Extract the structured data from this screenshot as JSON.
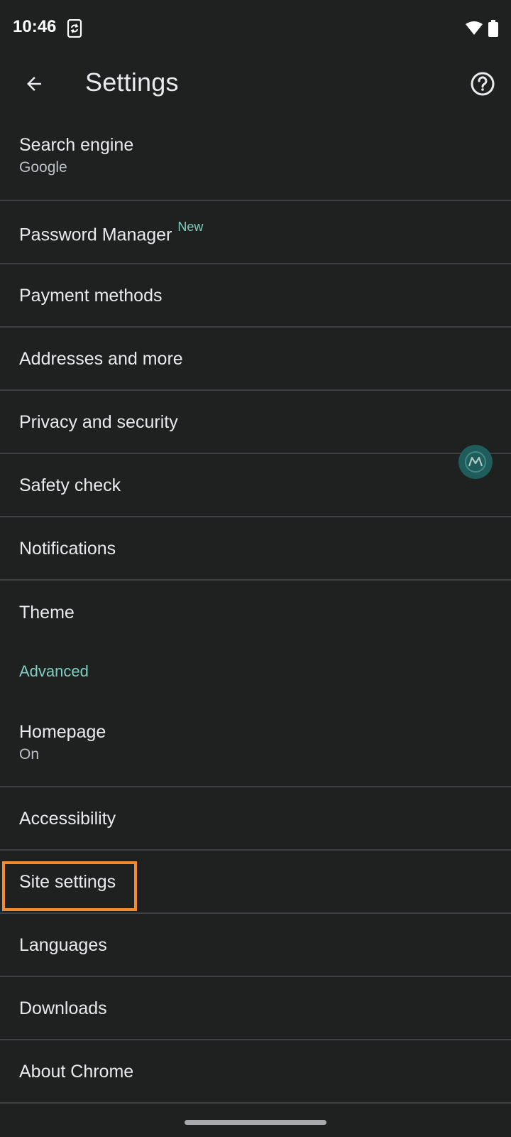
{
  "status_bar": {
    "time": "10:46",
    "icons": [
      "sync-icon",
      "wifi-icon",
      "battery-icon"
    ]
  },
  "app_bar": {
    "title": "Settings",
    "back_icon": "arrow-back-icon",
    "help_icon": "help-circle-icon"
  },
  "settings": {
    "search_engine": {
      "title": "Search engine",
      "subtitle": "Google"
    },
    "password_manager": {
      "title": "Password Manager",
      "badge": "New"
    },
    "payment_methods": {
      "title": "Payment methods"
    },
    "addresses": {
      "title": "Addresses and more"
    },
    "privacy": {
      "title": "Privacy and security"
    },
    "safety_check": {
      "title": "Safety check"
    },
    "notifications": {
      "title": "Notifications"
    },
    "theme": {
      "title": "Theme"
    },
    "advanced_header": "Advanced",
    "homepage": {
      "title": "Homepage",
      "subtitle": "On"
    },
    "accessibility": {
      "title": "Accessibility"
    },
    "site_settings": {
      "title": "Site settings"
    },
    "languages": {
      "title": "Languages"
    },
    "downloads": {
      "title": "Downloads"
    },
    "about_chrome": {
      "title": "About Chrome"
    }
  },
  "colors": {
    "background": "#1f2020",
    "accent": "#7fcfc0",
    "divider": "#3c4043",
    "highlight": "#f58a2c"
  }
}
